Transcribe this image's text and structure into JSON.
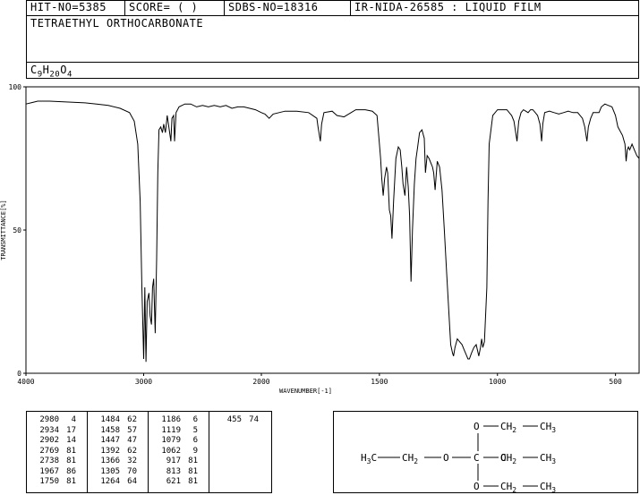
{
  "header": {
    "hit_no": "HIT-NO=5385",
    "score": "SCORE=  (   )",
    "sdbs_no": "SDBS-NO=18316",
    "ir_info": "IR-NIDA-26585 : LIQUID FILM",
    "compound_name": "TETRAETHYL ORTHOCARBONATE",
    "formula": {
      "c": "C",
      "c_n": "9",
      "h": "H",
      "h_n": "20",
      "o": "O",
      "o_n": "4"
    }
  },
  "chart_data": {
    "type": "line",
    "xlabel": "WAVENUMBER[-1]",
    "ylabel": "TRANSMITTANCE[%]",
    "xlim": [
      4000,
      400
    ],
    "ylim": [
      0,
      100
    ],
    "x_ticks": [
      4000,
      3000,
      2000,
      1500,
      1000,
      500
    ],
    "y_ticks": [
      0,
      50,
      100
    ],
    "grid": false,
    "series": [
      {
        "points": [
          [
            4000,
            94
          ],
          [
            3950,
            94.5
          ],
          [
            3900,
            95
          ],
          [
            3800,
            95
          ],
          [
            3700,
            94.8
          ],
          [
            3600,
            94.6
          ],
          [
            3500,
            94.4
          ],
          [
            3400,
            94
          ],
          [
            3300,
            93.5
          ],
          [
            3200,
            92.5
          ],
          [
            3120,
            91
          ],
          [
            3080,
            88
          ],
          [
            3050,
            80
          ],
          [
            3030,
            60
          ],
          [
            3015,
            30
          ],
          [
            3000,
            5
          ],
          [
            2990,
            30
          ],
          [
            2980,
            4
          ],
          [
            2970,
            25
          ],
          [
            2955,
            28
          ],
          [
            2945,
            20
          ],
          [
            2934,
            17
          ],
          [
            2925,
            30
          ],
          [
            2915,
            33
          ],
          [
            2902,
            14
          ],
          [
            2890,
            40
          ],
          [
            2880,
            70
          ],
          [
            2870,
            85
          ],
          [
            2855,
            86
          ],
          [
            2840,
            84
          ],
          [
            2830,
            87
          ],
          [
            2815,
            84
          ],
          [
            2800,
            90
          ],
          [
            2769,
            81
          ],
          [
            2760,
            89
          ],
          [
            2745,
            90
          ],
          [
            2738,
            81
          ],
          [
            2725,
            91
          ],
          [
            2700,
            93
          ],
          [
            2650,
            94
          ],
          [
            2600,
            94
          ],
          [
            2550,
            93
          ],
          [
            2500,
            93.5
          ],
          [
            2450,
            93
          ],
          [
            2400,
            93.5
          ],
          [
            2350,
            93
          ],
          [
            2300,
            93.5
          ],
          [
            2250,
            92.5
          ],
          [
            2200,
            93
          ],
          [
            2150,
            93
          ],
          [
            2100,
            92.5
          ],
          [
            2050,
            92
          ],
          [
            2000,
            91
          ],
          [
            1985,
            90.5
          ],
          [
            1967,
            89
          ],
          [
            1950,
            90.5
          ],
          [
            1900,
            91.5
          ],
          [
            1850,
            91.5
          ],
          [
            1800,
            91
          ],
          [
            1765,
            89
          ],
          [
            1760,
            86
          ],
          [
            1750,
            81
          ],
          [
            1745,
            87
          ],
          [
            1735,
            91
          ],
          [
            1700,
            91.5
          ],
          [
            1680,
            90
          ],
          [
            1650,
            89.5
          ],
          [
            1620,
            91
          ],
          [
            1600,
            92
          ],
          [
            1560,
            92
          ],
          [
            1530,
            91.5
          ],
          [
            1510,
            90
          ],
          [
            1500,
            80
          ],
          [
            1495,
            75
          ],
          [
            1490,
            68
          ],
          [
            1484,
            62
          ],
          [
            1478,
            68
          ],
          [
            1470,
            72
          ],
          [
            1465,
            70
          ],
          [
            1458,
            57
          ],
          [
            1452,
            55
          ],
          [
            1447,
            47
          ],
          [
            1440,
            60
          ],
          [
            1430,
            75
          ],
          [
            1420,
            79
          ],
          [
            1412,
            78
          ],
          [
            1405,
            72
          ],
          [
            1400,
            66
          ],
          [
            1392,
            62
          ],
          [
            1385,
            72
          ],
          [
            1378,
            65
          ],
          [
            1372,
            55
          ],
          [
            1366,
            32
          ],
          [
            1360,
            50
          ],
          [
            1352,
            66
          ],
          [
            1345,
            75
          ],
          [
            1338,
            79
          ],
          [
            1330,
            84
          ],
          [
            1320,
            85
          ],
          [
            1310,
            82
          ],
          [
            1305,
            70
          ],
          [
            1298,
            76
          ],
          [
            1290,
            75
          ],
          [
            1280,
            73
          ],
          [
            1275,
            72
          ],
          [
            1270,
            70
          ],
          [
            1264,
            64
          ],
          [
            1255,
            74
          ],
          [
            1245,
            72
          ],
          [
            1235,
            64
          ],
          [
            1225,
            50
          ],
          [
            1215,
            35
          ],
          [
            1205,
            20
          ],
          [
            1198,
            10
          ],
          [
            1190,
            7
          ],
          [
            1186,
            6
          ],
          [
            1180,
            9
          ],
          [
            1170,
            12
          ],
          [
            1160,
            11
          ],
          [
            1150,
            10
          ],
          [
            1140,
            8
          ],
          [
            1130,
            6
          ],
          [
            1125,
            5
          ],
          [
            1119,
            5
          ],
          [
            1110,
            7
          ],
          [
            1100,
            9
          ],
          [
            1090,
            10
          ],
          [
            1079,
            6
          ],
          [
            1072,
            9
          ],
          [
            1067,
            12
          ],
          [
            1062,
            9
          ],
          [
            1055,
            11
          ],
          [
            1045,
            30
          ],
          [
            1040,
            60
          ],
          [
            1035,
            80
          ],
          [
            1020,
            90
          ],
          [
            1000,
            92
          ],
          [
            980,
            92
          ],
          [
            960,
            92
          ],
          [
            950,
            91
          ],
          [
            940,
            90
          ],
          [
            930,
            88
          ],
          [
            917,
            81
          ],
          [
            910,
            88
          ],
          [
            900,
            91
          ],
          [
            890,
            92
          ],
          [
            880,
            91.5
          ],
          [
            870,
            91
          ],
          [
            860,
            92
          ],
          [
            850,
            92
          ],
          [
            840,
            91
          ],
          [
            830,
            90
          ],
          [
            820,
            87
          ],
          [
            813,
            81
          ],
          [
            808,
            87
          ],
          [
            800,
            91
          ],
          [
            780,
            91.5
          ],
          [
            760,
            91
          ],
          [
            740,
            90.5
          ],
          [
            720,
            91
          ],
          [
            700,
            91.5
          ],
          [
            680,
            91
          ],
          [
            660,
            91
          ],
          [
            640,
            89
          ],
          [
            630,
            86
          ],
          [
            621,
            81
          ],
          [
            615,
            86
          ],
          [
            605,
            89
          ],
          [
            595,
            91
          ],
          [
            585,
            91
          ],
          [
            570,
            91
          ],
          [
            560,
            93
          ],
          [
            545,
            94
          ],
          [
            530,
            93.5
          ],
          [
            515,
            93
          ],
          [
            500,
            90
          ],
          [
            490,
            86
          ],
          [
            470,
            83
          ],
          [
            460,
            80
          ],
          [
            455,
            74
          ],
          [
            450,
            78
          ],
          [
            445,
            79
          ],
          [
            440,
            78
          ],
          [
            430,
            80
          ],
          [
            420,
            78
          ],
          [
            410,
            76
          ],
          [
            400,
            75
          ]
        ]
      }
    ]
  },
  "peaks": {
    "columns": [
      [
        [
          "2980",
          "4"
        ],
        [
          "2934",
          "17"
        ],
        [
          "2902",
          "14"
        ],
        [
          "2769",
          "81"
        ],
        [
          "2738",
          "81"
        ],
        [
          "1967",
          "86"
        ],
        [
          "1750",
          "81"
        ]
      ],
      [
        [
          "1484",
          "62"
        ],
        [
          "1458",
          "57"
        ],
        [
          "1447",
          "47"
        ],
        [
          "1392",
          "62"
        ],
        [
          "1366",
          "32"
        ],
        [
          "1305",
          "70"
        ],
        [
          "1264",
          "64"
        ]
      ],
      [
        [
          "1186",
          "6"
        ],
        [
          "1119",
          "5"
        ],
        [
          "1079",
          "6"
        ],
        [
          "1062",
          "9"
        ],
        [
          "917",
          "81"
        ],
        [
          "813",
          "81"
        ],
        [
          "621",
          "81"
        ]
      ],
      [
        [
          "455",
          "74"
        ]
      ]
    ]
  },
  "structure": {
    "top_o": "O",
    "top_ch2": "CH",
    "top_ch2_sub": "2",
    "top_ch3": "CH",
    "top_ch3_sub": "3",
    "left_h3c": "H",
    "left_h3c_sub": "3",
    "left_h3c_c": "C",
    "left_ch2": "CH",
    "left_ch2_sub": "2",
    "left_o": "O",
    "center_c": "C",
    "right_o": "O",
    "right_ch2": "CH",
    "right_ch2_sub": "2",
    "right_ch3": "CH",
    "right_ch3_sub": "3",
    "bottom_o": "O",
    "bottom_ch2": "CH",
    "bottom_ch2_sub": "2",
    "bottom_ch3": "CH",
    "bottom_ch3_sub": "3"
  }
}
